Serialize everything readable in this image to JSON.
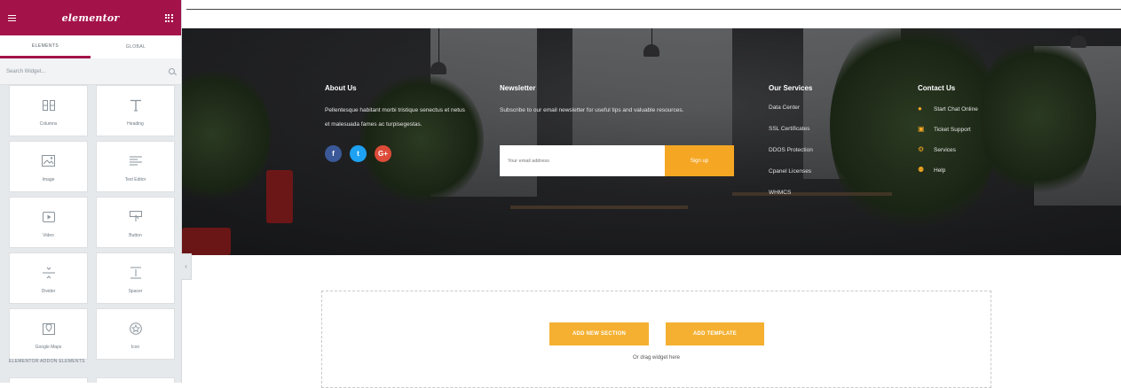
{
  "panel": {
    "logo": "elementor",
    "tabs": [
      "ELEMENTS",
      "GLOBAL"
    ],
    "search_placeholder": "Search Widget...",
    "widgets": [
      {
        "label": "Columns",
        "icon": "columns-icon"
      },
      {
        "label": "Heading",
        "icon": "heading-icon"
      },
      {
        "label": "Image",
        "icon": "image-icon"
      },
      {
        "label": "Text Editor",
        "icon": "text-editor-icon"
      },
      {
        "label": "Video",
        "icon": "video-icon"
      },
      {
        "label": "Button",
        "icon": "button-icon"
      },
      {
        "label": "Divider",
        "icon": "divider-icon"
      },
      {
        "label": "Spacer",
        "icon": "spacer-icon"
      },
      {
        "label": "Google Maps",
        "icon": "map-icon"
      },
      {
        "label": "Icon",
        "icon": "star-icon"
      }
    ],
    "addons_title": "ELEMENTOR ADDON ELEMENTS"
  },
  "footer": {
    "about": {
      "title": "About Us",
      "text": "Pellentesque habitant morbi tristique senectus et netus et malesuada fames ac turpisegestas."
    },
    "social": [
      {
        "label": "f",
        "color": "#3b5998",
        "icon": "facebook-icon"
      },
      {
        "label": "t",
        "color": "#1da1f2",
        "icon": "twitter-icon"
      },
      {
        "label": "G+",
        "color": "#dd4b39",
        "icon": "google-plus-icon"
      }
    ],
    "newsletter": {
      "title": "Newsletter",
      "text": "Subscribe to our email newsletter for useful tips and valuable resources.",
      "placeholder": "Your email address",
      "button": "Sign up"
    },
    "services": {
      "title": "Our Services",
      "items": [
        "Data Center",
        "SSL Certificates",
        "DDOS Protection",
        "Cpanel Licenses",
        "WHMCS"
      ]
    },
    "contact": {
      "title": "Contact Us",
      "items": [
        {
          "label": "Start Chat Online",
          "icon": "chat-icon"
        },
        {
          "label": "Ticket Support",
          "icon": "ticket-icon"
        },
        {
          "label": "Services",
          "icon": "gears-icon"
        },
        {
          "label": "Help",
          "icon": "help-icon"
        }
      ]
    }
  },
  "dropzone": {
    "add_section": "ADD NEW SECTION",
    "add_template": "ADD TEMPLATE",
    "hint": "Or drag widget here"
  },
  "colors": {
    "brand": "#a4124a",
    "accent": "#f5a623"
  }
}
